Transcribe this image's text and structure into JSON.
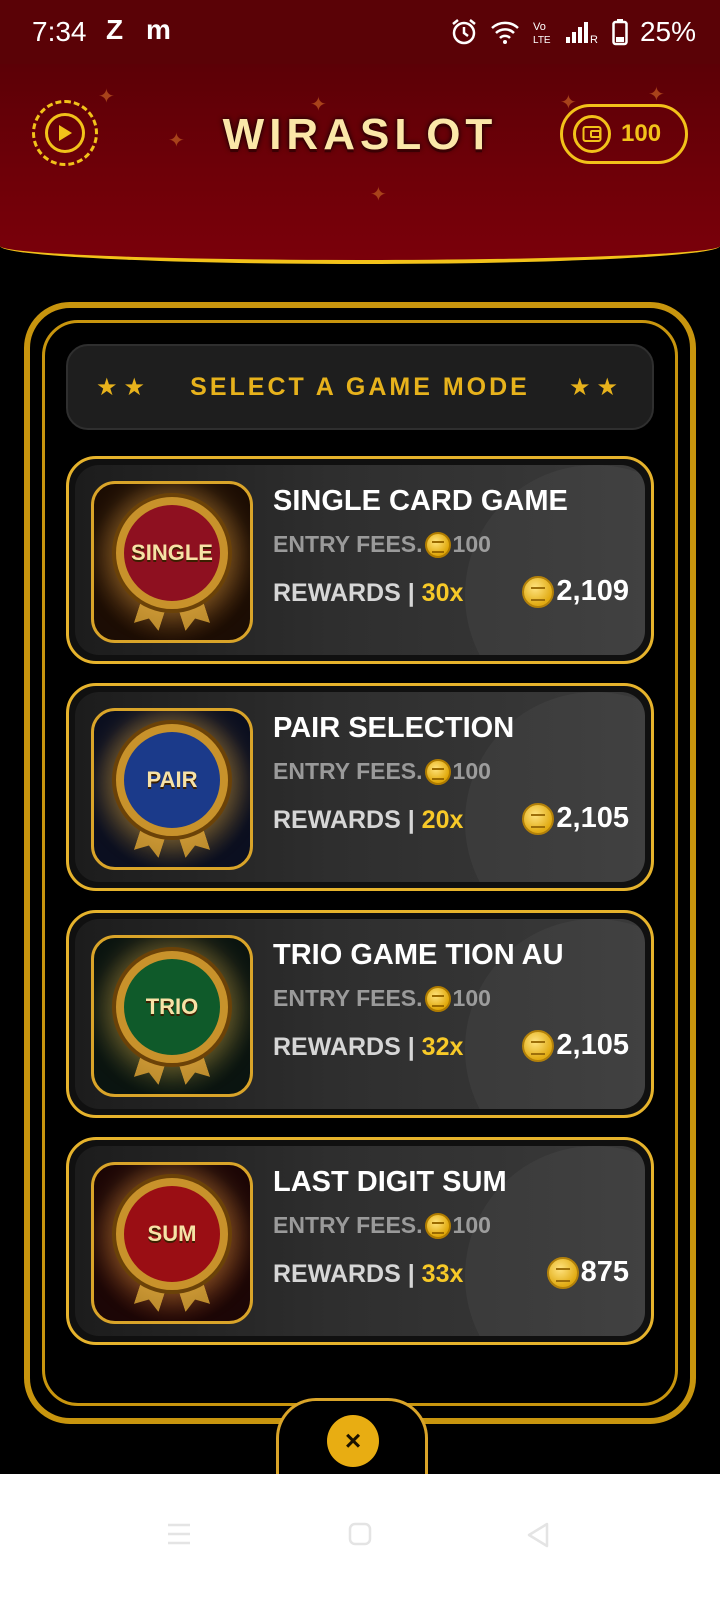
{
  "status_bar": {
    "time": "7:34",
    "app_icons": [
      "Z",
      "m"
    ],
    "battery": "25%"
  },
  "header": {
    "title": "WIRASLOT",
    "wallet_amount": "100"
  },
  "mode_panel": {
    "title": "SELECT A GAME MODE"
  },
  "games": [
    {
      "badge": "SINGLE",
      "name": "SINGLE CARD GAME",
      "entry_label": "ENTRY FEES.",
      "entry_fee": "100",
      "rewards_label": "REWARDS | ",
      "multiplier": "30x",
      "prize": "2,109",
      "badge_color": "#8e1020"
    },
    {
      "badge": "PAIR",
      "name": "PAIR SELECTION",
      "entry_label": "ENTRY FEES.",
      "entry_fee": "100",
      "rewards_label": "REWARDS | ",
      "multiplier": "20x",
      "prize": "2,105",
      "badge_color": "#1b3a8a"
    },
    {
      "badge": "TRIO",
      "name": "TRIO GAME TION AU",
      "entry_label": "ENTRY FEES.",
      "entry_fee": "100",
      "rewards_label": "REWARDS | ",
      "multiplier": "32x",
      "prize": "2,105",
      "badge_color": "#0f5a2a"
    },
    {
      "badge": "SUM",
      "name": "LAST DIGIT SUM",
      "entry_label": "ENTRY FEES.",
      "entry_fee": "100",
      "rewards_label": "REWARDS | ",
      "multiplier": "33x",
      "prize": "875",
      "badge_color": "#9a0e14"
    }
  ],
  "close_icon": "×",
  "colors": {
    "gold": "#f2c21a",
    "header_red": "#6e0008",
    "accent_yellow": "#f7c928"
  }
}
